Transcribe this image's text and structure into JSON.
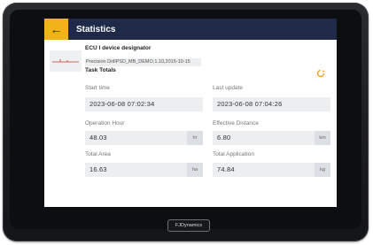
{
  "app": {
    "title": "Statistics",
    "back_icon": "arrow-left-icon"
  },
  "device": {
    "title": "ECU I device designator",
    "model": "Precision DrillPSD_MB_DEMO,1.10,2015-10-15"
  },
  "section_title": "Task Totals",
  "fields": {
    "start_time": {
      "label": "Start time",
      "value": "2023-06-08 07:02:34"
    },
    "last_update": {
      "label": "Last update",
      "value": "2023-06-08 07:04:26"
    },
    "operation_hour": {
      "label": "Operation Hour",
      "value": "48.03",
      "unit": "hr"
    },
    "effective_distance": {
      "label": "Effective Distance",
      "value": "6.80",
      "unit": "km"
    },
    "total_area": {
      "label": "Total Area",
      "value": "16.63",
      "unit": "ha"
    },
    "total_application": {
      "label": "Total Application",
      "value": "74.84",
      "unit": "kg"
    }
  },
  "brand": {
    "label": "FJDynamics"
  },
  "colors": {
    "header": "#1f2a48",
    "accent": "#f2b21a",
    "refresh": "#f0a020"
  }
}
